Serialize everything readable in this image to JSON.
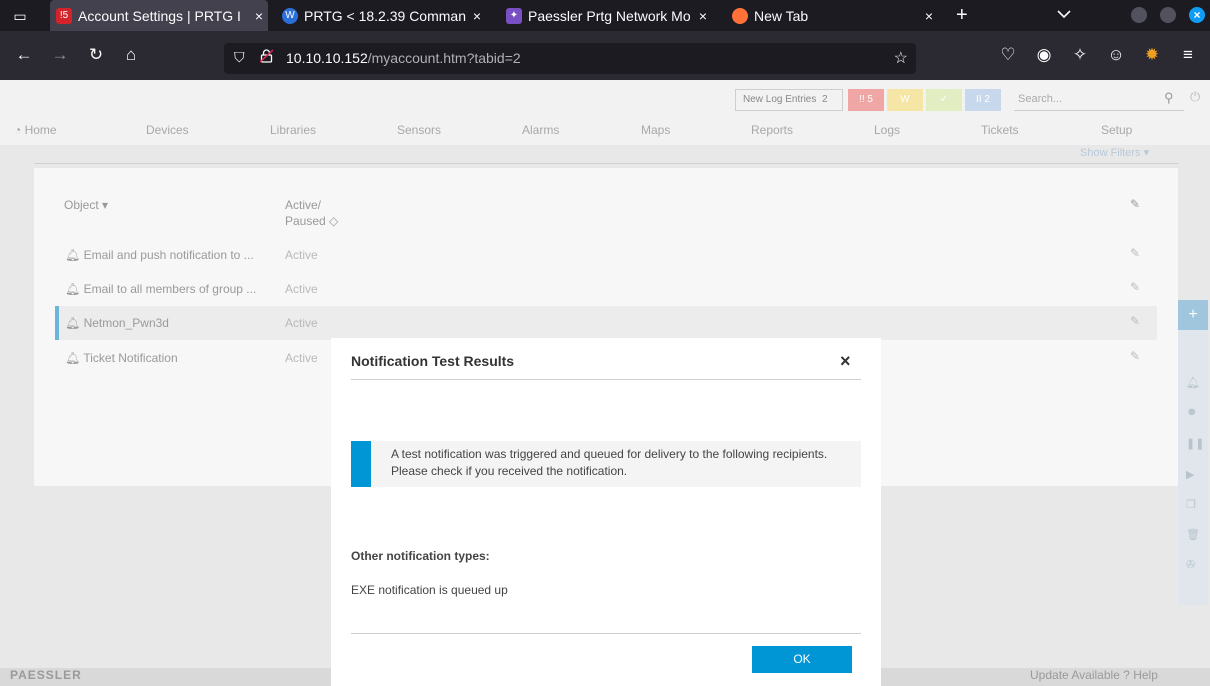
{
  "browser": {
    "tabs": [
      {
        "title": "Account Settings | PRTG I",
        "favicon": "prtg-favicon",
        "favicon_text": "!5",
        "active": true
      },
      {
        "title": "PRTG < 18.2.39 Comman",
        "favicon": "wordpress-favicon",
        "favicon_text": "W",
        "active": false
      },
      {
        "title": "Paessler Prtg Network Mo",
        "favicon": "exploit-favicon",
        "favicon_text": "",
        "active": false
      },
      {
        "title": "New Tab",
        "favicon": "firefox-favicon",
        "favicon_text": "",
        "active": false
      }
    ],
    "url_host": "10.10.10.152",
    "url_path": "/myaccount.htm?tabid=2"
  },
  "prtg": {
    "log_entries_label": "New Log Entries",
    "log_entries_count": "2",
    "status_badges": [
      {
        "text": "!! 5",
        "color": "#f1a6a6"
      },
      {
        "text": "W",
        "color": "#f6e6a6"
      },
      {
        "text": "✓",
        "color": "#e2eec2"
      },
      {
        "text": "II 2",
        "color": "#c8d8ec"
      }
    ],
    "search_placeholder": "Search...",
    "menu": [
      "Home",
      "Devices",
      "Libraries",
      "Sensors",
      "Alarms",
      "Maps",
      "Reports",
      "Logs",
      "Tickets",
      "Setup"
    ],
    "show_filters": "Show Filters ▾",
    "columns": {
      "object": "Object ▾",
      "active_line1": "Active/",
      "active_line2": "Paused ◇"
    },
    "rows": [
      {
        "name": "Email and push notification to ...",
        "status": "Active"
      },
      {
        "name": "Email to all members of group ...",
        "status": "Active"
      },
      {
        "name": "Netmon_Pwn3d",
        "status": "Active"
      },
      {
        "name": "Ticket Notification",
        "status": "Active"
      }
    ],
    "footer_brand": "PAESSLER",
    "footer_right": "Update Available    ? Help"
  },
  "modal": {
    "title": "Notification Test Results",
    "info": "A test notification was triggered and queued for delivery to the following recipients. Please check if you received the notification.",
    "other_title": "Other notification types:",
    "other_line": "EXE notification is queued up",
    "ok_label": "OK"
  }
}
